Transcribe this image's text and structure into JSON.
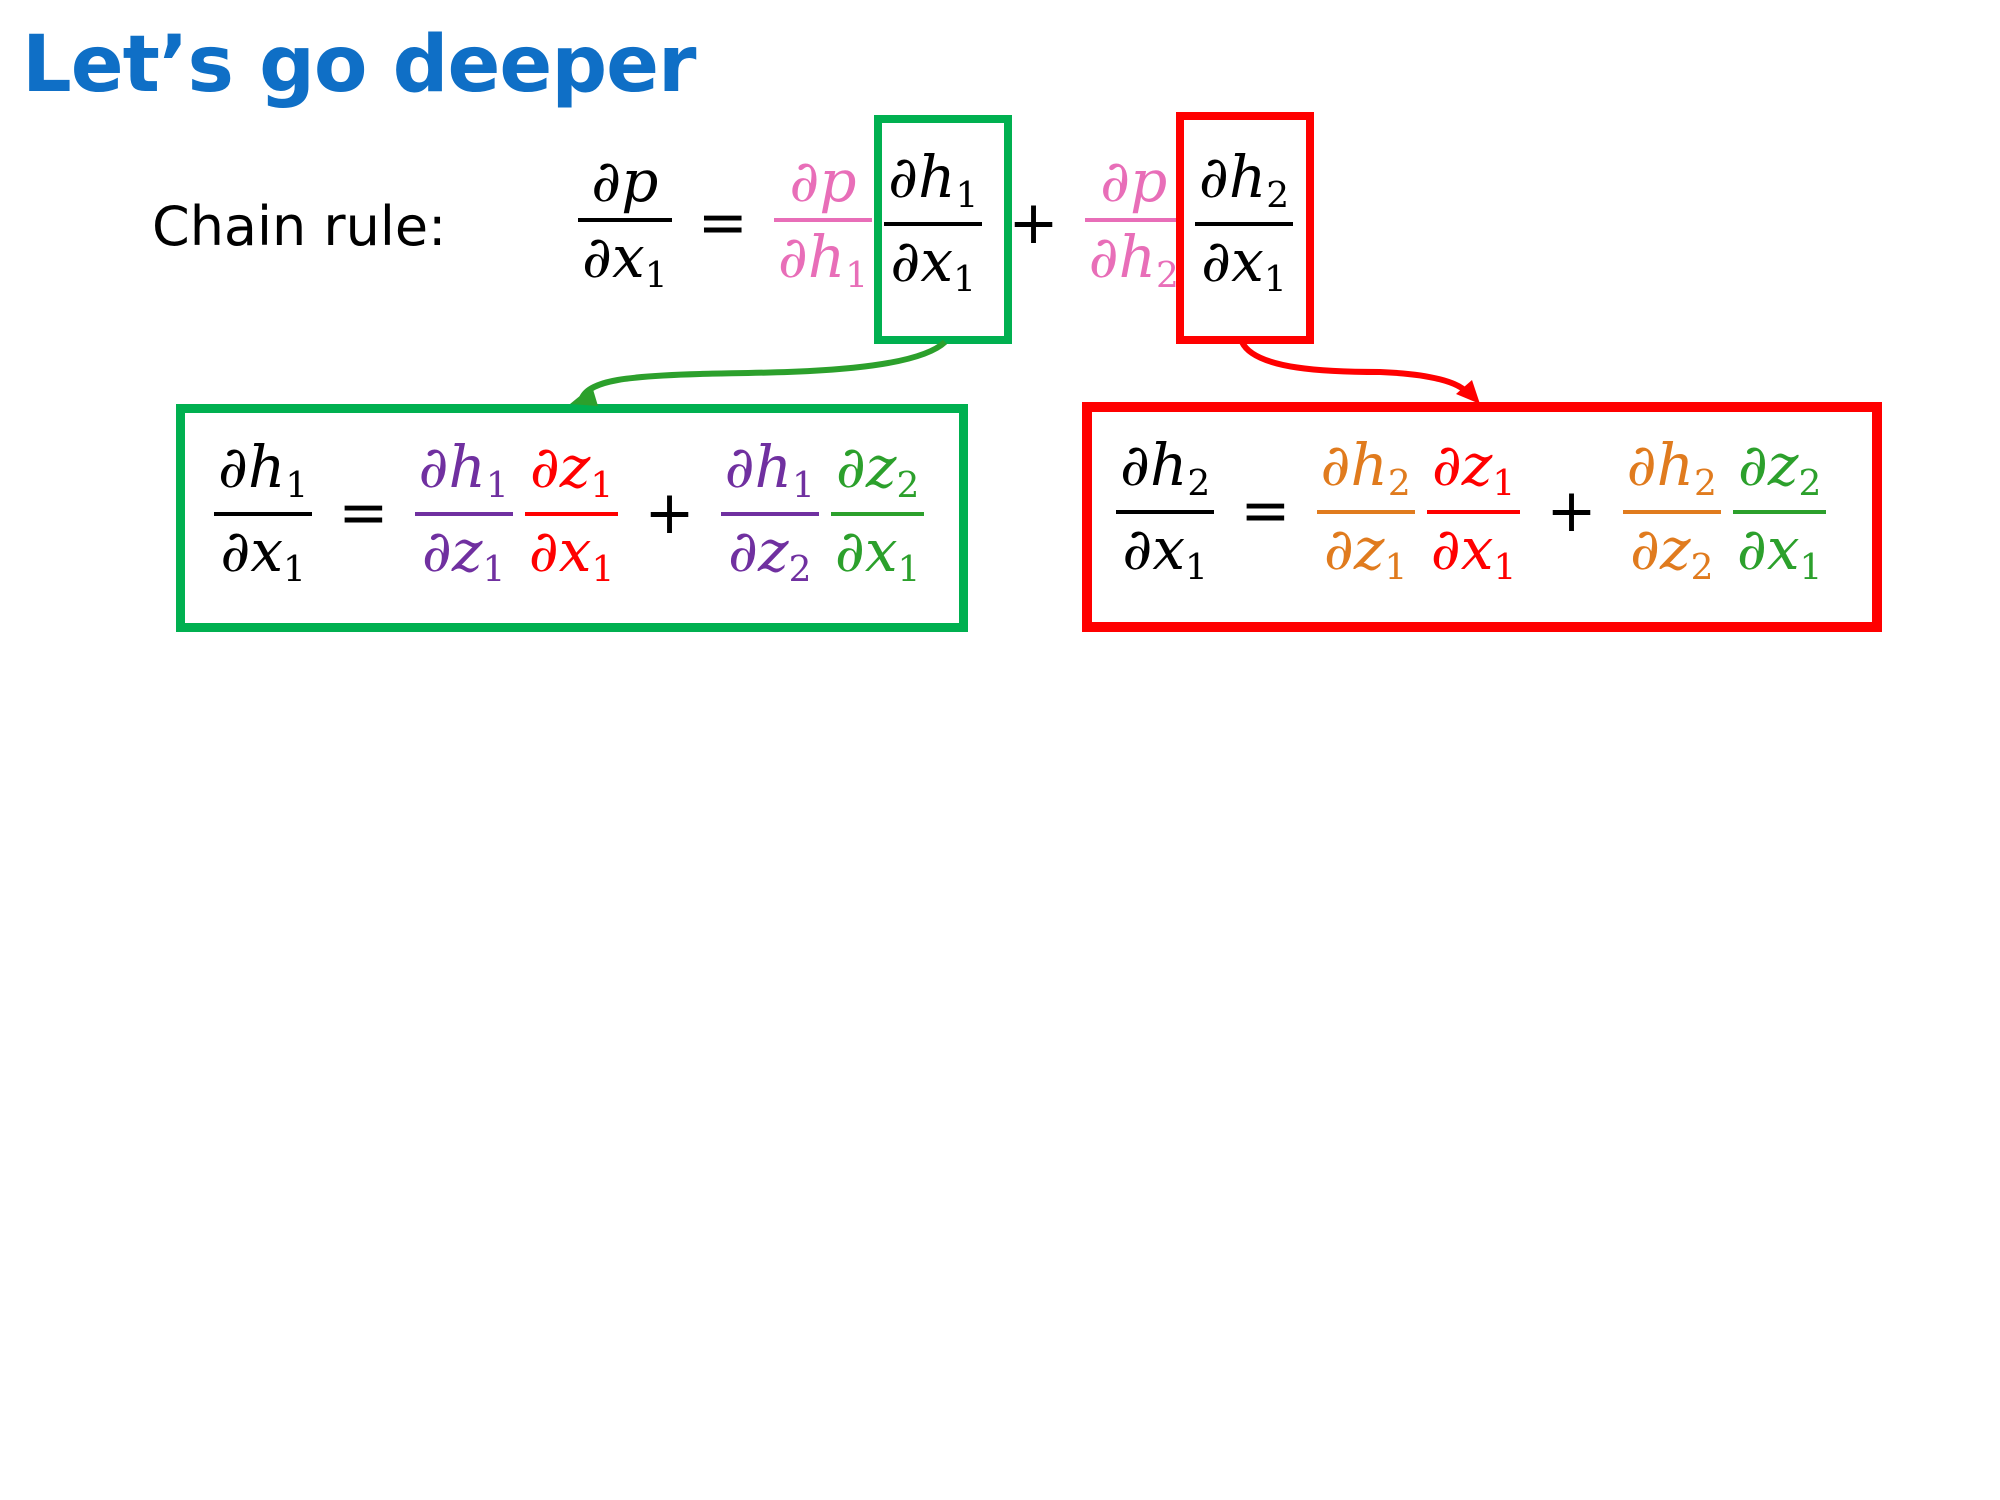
{
  "title": "Let’s go deeper",
  "label": "Chain rule:",
  "colors": {
    "title": "#0F6FC6",
    "black": "#000000",
    "pink": "#E86EB8",
    "purple": "#7030A0",
    "red": "#FF0000",
    "green": "#2CA02C",
    "orange": "#E07B1E",
    "green_box": "#00B050",
    "red_box": "#FF0000"
  },
  "top_equation": [
    {
      "type": "frac",
      "num": "∂p",
      "den": "∂x",
      "den_sub": "1",
      "color": "black"
    },
    {
      "type": "op",
      "text": "="
    },
    {
      "type": "frac",
      "num": "∂p",
      "den": "∂h",
      "den_sub": "1",
      "color": "pink"
    },
    {
      "type": "frac",
      "num": "∂h",
      "num_sub": "1",
      "den": "∂x",
      "den_sub": "1",
      "color": "black"
    },
    {
      "type": "op",
      "text": "+"
    },
    {
      "type": "frac",
      "num": "∂p",
      "den": "∂h",
      "den_sub": "2",
      "color": "pink"
    },
    {
      "type": "frac",
      "num": "∂h",
      "num_sub": "2",
      "den": "∂x",
      "den_sub": "1",
      "color": "black"
    }
  ],
  "left_equation": [
    {
      "type": "frac",
      "num": "∂h",
      "num_sub": "1",
      "den": "∂x",
      "den_sub": "1",
      "color": "black"
    },
    {
      "type": "op",
      "text": "="
    },
    {
      "type": "frac",
      "num": "∂h",
      "num_sub": "1",
      "den": "∂z",
      "den_sub": "1",
      "color": "purple"
    },
    {
      "type": "frac",
      "num": "∂z",
      "num_sub": "1",
      "den": "∂x",
      "den_sub": "1",
      "color": "red"
    },
    {
      "type": "op",
      "text": "+"
    },
    {
      "type": "frac",
      "num": "∂h",
      "num_sub": "1",
      "den": "∂z",
      "den_sub": "2",
      "color": "purple"
    },
    {
      "type": "frac",
      "num": "∂z",
      "num_sub": "2",
      "den": "∂x",
      "den_sub": "1",
      "color": "green"
    }
  ],
  "right_equation": [
    {
      "type": "frac",
      "num": "∂h",
      "num_sub": "2",
      "den": "∂x",
      "den_sub": "1",
      "color": "black"
    },
    {
      "type": "op",
      "text": "="
    },
    {
      "type": "frac",
      "num": "∂h",
      "num_sub": "2",
      "den": "∂z",
      "den_sub": "1",
      "color": "orange"
    },
    {
      "type": "frac",
      "num": "∂z",
      "num_sub": "1",
      "den": "∂x",
      "den_sub": "1",
      "color": "red"
    },
    {
      "type": "op",
      "text": "+"
    },
    {
      "type": "frac",
      "num": "∂h",
      "num_sub": "2",
      "den": "∂z",
      "den_sub": "2",
      "color": "orange"
    },
    {
      "type": "frac",
      "num": "∂z",
      "num_sub": "2",
      "den": "∂x",
      "den_sub": "1",
      "color": "green"
    }
  ]
}
